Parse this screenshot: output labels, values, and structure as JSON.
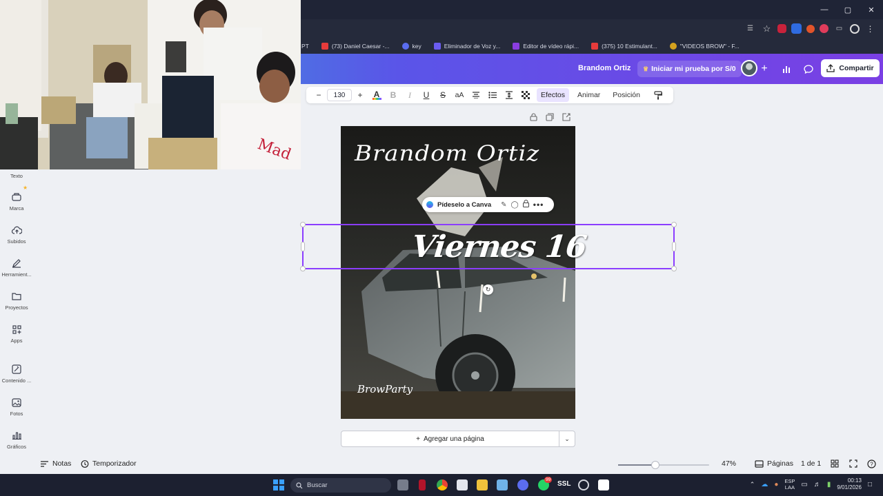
{
  "bookmarks": [
    {
      "label": "PT",
      "color": "#4a4f60"
    },
    {
      "label": "(73) Daniel Caesar -...",
      "color": "#e63b3b"
    },
    {
      "label": "key",
      "color": "#5a6df0"
    },
    {
      "label": "Eliminador de Voz y...",
      "color": "#6b5cf0"
    },
    {
      "label": "Editor de vídeo rápi...",
      "color": "#8a3de0"
    },
    {
      "label": "(375) 10 Estimulant...",
      "color": "#e63b3b"
    },
    {
      "label": "\"VIDEOS BROW\" - F...",
      "color": "#d4a11e"
    }
  ],
  "header": {
    "doc_title": "Brandom Ortiz",
    "trial_label": "Iniciar mi prueba por S/0",
    "trial_icon": "crown-icon",
    "share_label": "Compartir"
  },
  "toolbar": {
    "minus": "−",
    "font_size": "130",
    "plus": "+",
    "text_color_glyph": "A",
    "bold": "B",
    "italic": "I",
    "underline": "U",
    "strike": "S",
    "case": "aA",
    "effects": "Efectos",
    "animate": "Animar",
    "position": "Posición"
  },
  "sidebar": {
    "items": [
      {
        "label": "Texto",
        "icon": "text-icon"
      },
      {
        "label": "Marca",
        "icon": "brand-icon"
      },
      {
        "label": "Subidos",
        "icon": "cloud-upload-icon"
      },
      {
        "label": "Herramient...",
        "icon": "pen-tool-icon"
      },
      {
        "label": "Proyectos",
        "icon": "folder-icon"
      },
      {
        "label": "Apps",
        "icon": "apps-icon"
      },
      {
        "label": "Contenido ...",
        "icon": "magic-media-icon"
      },
      {
        "label": "Fotos",
        "icon": "image-icon"
      },
      {
        "label": "Gráficos",
        "icon": "chart-icon"
      }
    ]
  },
  "canvas": {
    "ask_canva_label": "Pídeselo a Canva",
    "title_text": "Brandom Ortiz",
    "selected_text": "Viernes 16",
    "footer_text": "BrowParty",
    "add_page_label": "Agregar una página",
    "add_page_plus": "+"
  },
  "bottom": {
    "notes_label": "Notas",
    "timer_label": "Temporizador",
    "zoom_level": 47,
    "zoom_label": "47%",
    "pages_label": "Páginas",
    "page_count": "1 de 1"
  },
  "taskbar": {
    "search_placeholder": "Buscar",
    "badge_count": "99",
    "ssl_label": "SSL",
    "lang_top": "ESP",
    "lang_bottom": "LAA",
    "time": "00:13",
    "date": "9/01/2026"
  },
  "colors": {
    "accent": "#8b3dff",
    "header_start": "#2fb4d6",
    "header_end": "#7a3fe4"
  }
}
